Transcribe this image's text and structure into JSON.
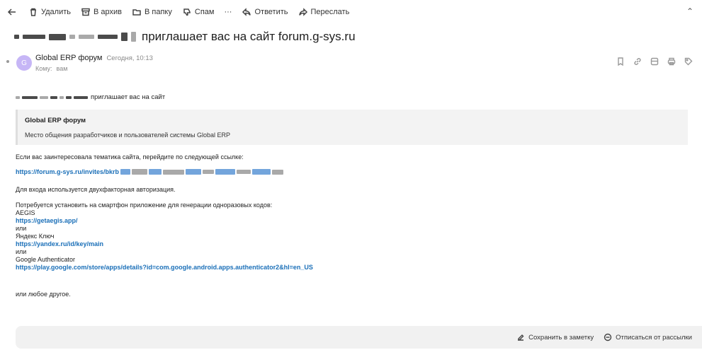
{
  "toolbar": {
    "back_icon": "arrow-left-icon",
    "delete": "Удалить",
    "archive": "В архив",
    "folder": "В папку",
    "spam": "Спам",
    "more": "···",
    "reply": "Ответить",
    "forward": "Переслать",
    "collapse": "⌃"
  },
  "message": {
    "subject": "приглашает вас на сайт forum.g-sys.ru",
    "avatar_letter": "G",
    "sender_name": "Global ERP форум",
    "time": "Сегодня, 10:13",
    "to_label": "Кому:",
    "to_value": "вам"
  },
  "body": {
    "invite_text": "приглашает вас на сайт",
    "card_title": "Global ERP форум",
    "card_desc": "Место общения разработчиков и пользователей системы Global ERP",
    "interest_line": "Если вас заинтересовала тематика сайта, перейдите по следующей ссылке:",
    "invite_link_prefix": "https://forum.g-sys.ru/invites/bkrb",
    "twofa_line": "Для входа используется двухфакторная авторизация.",
    "install_line": "Потребуется установить на смартфон приложение для генерации одноразовых кодов:",
    "app1_name": "AEGIS",
    "app1_link": "https://getaegis.app/",
    "or1": "или",
    "app2_name": "Яндекс Ключ",
    "app2_link": "https://yandex.ru/id/key/main",
    "or2": "или",
    "app3_name": "Google Authenticator",
    "app3_link": "https://play.google.com/store/apps/details?id=com.google.android.apps.authenticator2&hl=en_US",
    "any_other": "или любое другое."
  },
  "footer": {
    "save_note": "Сохранить в заметку",
    "unsubscribe": "Отписаться от рассылки"
  }
}
